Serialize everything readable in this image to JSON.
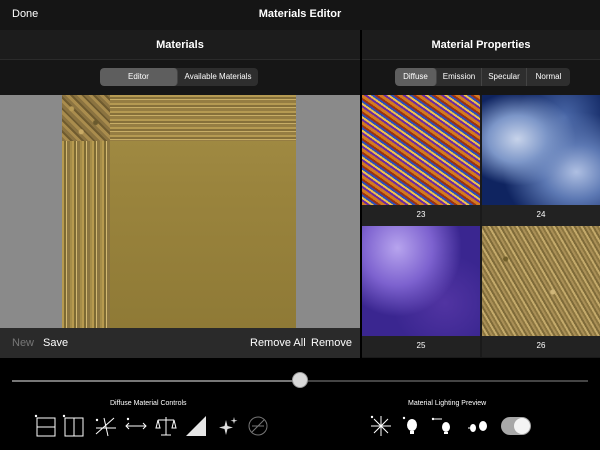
{
  "topbar": {
    "done_label": "Done",
    "title": "Materials Editor"
  },
  "materials_panel": {
    "title": "Materials",
    "segments": [
      {
        "label": "Editor",
        "selected": true
      },
      {
        "label": "Available Materials",
        "selected": false
      }
    ],
    "actions": {
      "new": "New",
      "save": "Save",
      "remove_all": "Remove All",
      "remove": "Remove"
    }
  },
  "properties_panel": {
    "title": "Material Properties",
    "segments": [
      {
        "label": "Diffuse",
        "selected": true
      },
      {
        "label": "Emission",
        "selected": false
      },
      {
        "label": "Specular",
        "selected": false
      },
      {
        "label": "Normal",
        "selected": false
      }
    ],
    "materials": [
      {
        "number": "23"
      },
      {
        "number": "24"
      },
      {
        "number": "25"
      },
      {
        "number": "26"
      }
    ]
  },
  "slider": {
    "value": 0.5
  },
  "controls": {
    "diffuse_label": "Diffuse Material Controls",
    "lighting_label": "Material Lighting Preview",
    "diffuse_icons": [
      "split-horizontal-icon",
      "split-vertical-icon",
      "tile-angle-icon",
      "stretch-arrows-icon",
      "balance-scale-icon",
      "gradient-ramp-icon",
      "sparkle-icon",
      "compass-icon"
    ],
    "lighting_icons": [
      "light-burst-icon",
      "spotlight-icon",
      "bulb-left-icon",
      "bulb-pair-icon"
    ],
    "lighting_toggle_on": true
  }
}
